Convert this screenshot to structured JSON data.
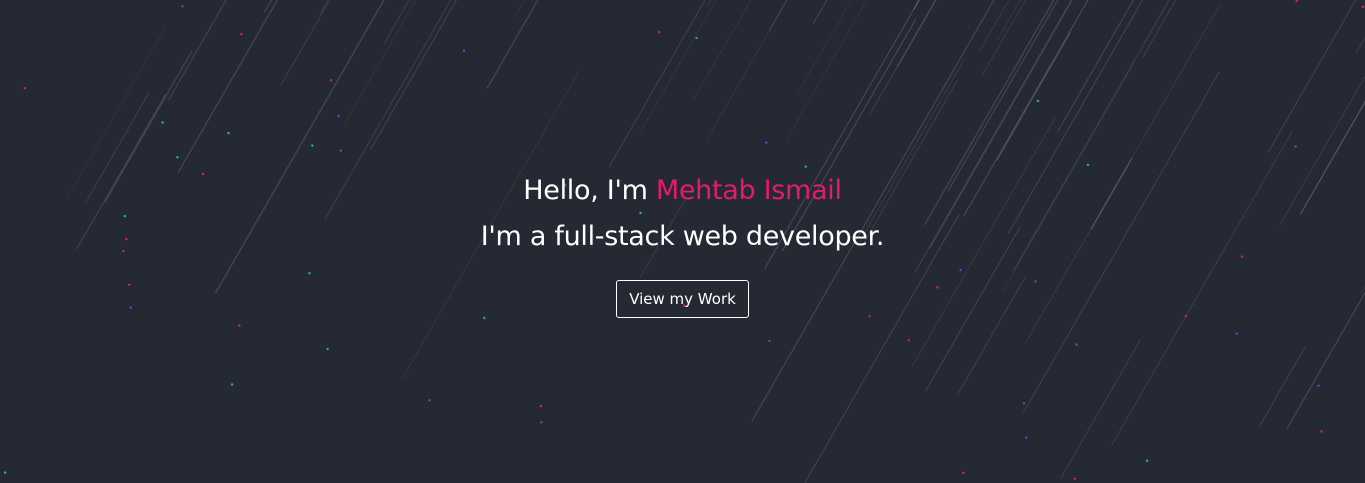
{
  "hero": {
    "greeting": "Hello, I'm ",
    "name": "Mehtab Ismail",
    "tagline": "I'm a full-stack web developer.",
    "cta_label": "View my Work"
  },
  "colors": {
    "background": "#252934",
    "accent": "#e31b6d",
    "text": "#ffffff"
  }
}
